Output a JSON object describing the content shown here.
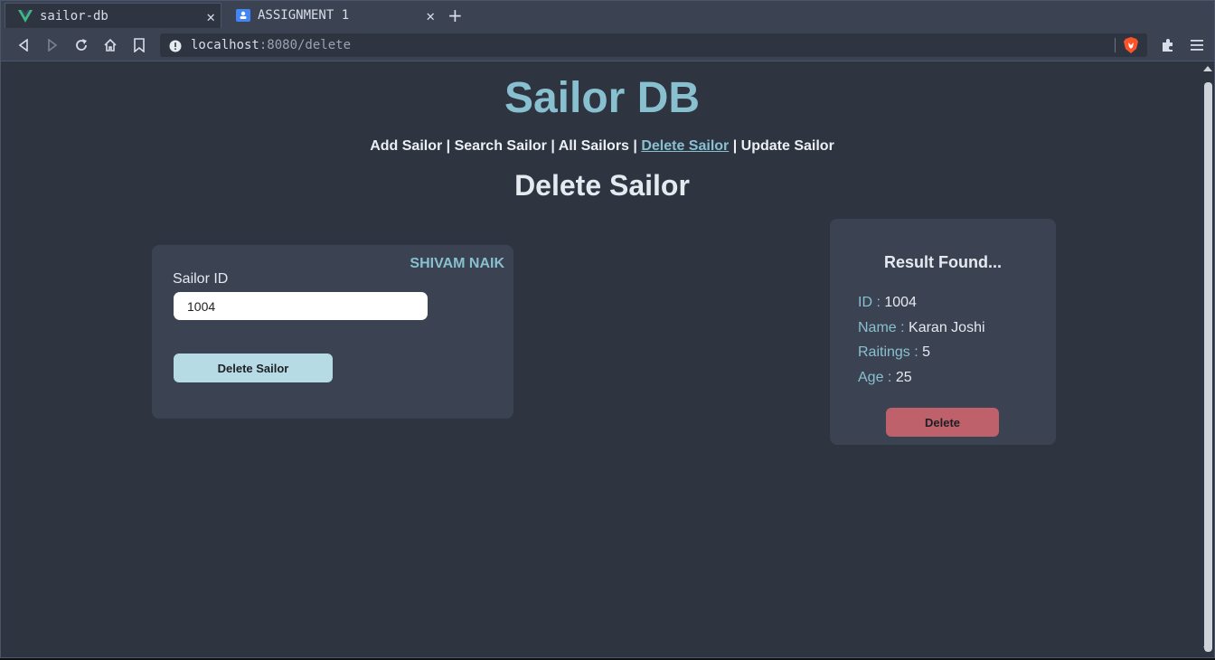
{
  "browser": {
    "tabs": [
      {
        "title": "sailor-db",
        "active": true
      },
      {
        "title": "ASSIGNMENT 1",
        "active": false
      }
    ],
    "url": {
      "host": "localhost",
      "path": ":8080/delete"
    }
  },
  "app": {
    "title": "Sailor DB",
    "nav": [
      {
        "label": "Add Sailor"
      },
      {
        "label": "Search Sailor"
      },
      {
        "label": "All Sailors"
      },
      {
        "label": "Delete Sailor"
      },
      {
        "label": "Update Sailor"
      }
    ],
    "separator": "|",
    "page_heading": "Delete Sailor"
  },
  "form": {
    "author": "SHIVAM NAIK",
    "field_label": "Sailor ID",
    "field_value": "1004",
    "submit_label": "Delete Sailor"
  },
  "result": {
    "title": "Result Found...",
    "rows": [
      {
        "key": "ID :",
        "value": "1004"
      },
      {
        "key": "Name :",
        "value": "Karan Joshi"
      },
      {
        "key": "Raitings :",
        "value": "5"
      },
      {
        "key": "Age :",
        "value": "25"
      }
    ],
    "action_label": "Delete"
  },
  "colors": {
    "accent": "#88c0d0",
    "danger": "#bf616a",
    "background": "#2e3440",
    "card": "#3b4252"
  }
}
